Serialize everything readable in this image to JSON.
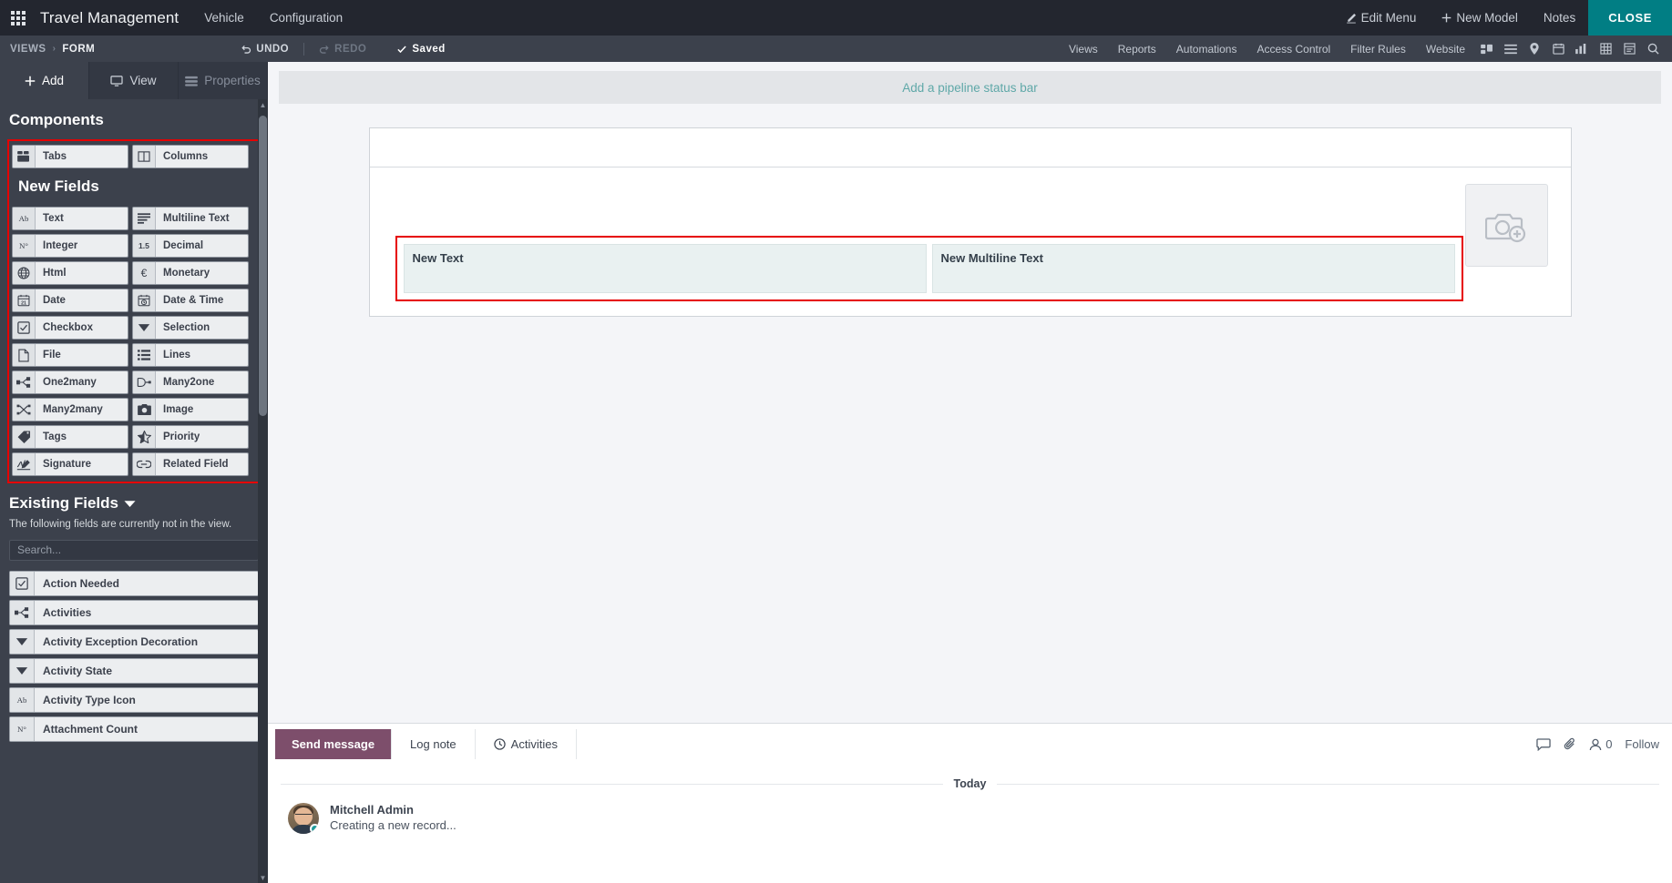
{
  "navbar": {
    "apps_icon": "apps-grid-icon",
    "brand": "Travel Management",
    "menus": [
      {
        "label": "Vehicle"
      },
      {
        "label": "Configuration"
      }
    ],
    "right_items": [
      {
        "label": "Edit Menu",
        "icon": "pencil-icon"
      },
      {
        "label": "New Model",
        "icon": "plus-icon"
      },
      {
        "label": "Notes",
        "icon": ""
      }
    ],
    "close_label": "CLOSE"
  },
  "subbar": {
    "breadcrumb": [
      {
        "label": "VIEWS",
        "active": false
      },
      {
        "label": "FORM",
        "active": true
      }
    ],
    "separator": "›",
    "undo_label": "UNDO",
    "redo_label": "REDO",
    "saved_label": "Saved",
    "links": [
      {
        "label": "Views"
      },
      {
        "label": "Reports"
      },
      {
        "label": "Automations"
      },
      {
        "label": "Access Control"
      },
      {
        "label": "Filter Rules"
      },
      {
        "label": "Website"
      }
    ],
    "view_icons": [
      "kanban-icon",
      "list-icon",
      "map-icon",
      "calendar-icon",
      "graph-icon",
      "pivot-icon",
      "form-icon",
      "search-icon"
    ]
  },
  "sidebar": {
    "tabs": [
      {
        "label": "Add",
        "icon": "plus-icon",
        "active": true,
        "dim": false
      },
      {
        "label": "View",
        "icon": "monitor-icon",
        "active": false,
        "dim": false
      },
      {
        "label": "Properties",
        "icon": "properties-icon",
        "active": false,
        "dim": true
      }
    ],
    "components_heading": "Components",
    "components": [
      {
        "label": "Tabs",
        "icon": "tabs-icon"
      },
      {
        "label": "Columns",
        "icon": "columns-icon"
      }
    ],
    "new_fields_heading": "New Fields",
    "new_fields": [
      {
        "label": "Text",
        "icon": "ab-icon"
      },
      {
        "label": "Multiline Text",
        "icon": "lines-text-icon"
      },
      {
        "label": "Integer",
        "icon": "n-degree-icon"
      },
      {
        "label": "Decimal",
        "icon": "decimal-icon"
      },
      {
        "label": "Html",
        "icon": "globe-icon"
      },
      {
        "label": "Monetary",
        "icon": "euro-icon"
      },
      {
        "label": "Date",
        "icon": "calendar-21-icon"
      },
      {
        "label": "Date & Time",
        "icon": "calendar-clock-icon"
      },
      {
        "label": "Checkbox",
        "icon": "checkbox-icon"
      },
      {
        "label": "Selection",
        "icon": "caret-down-icon"
      },
      {
        "label": "File",
        "icon": "file-icon"
      },
      {
        "label": "Lines",
        "icon": "list-bullets-icon"
      },
      {
        "label": "One2many",
        "icon": "one2many-icon"
      },
      {
        "label": "Many2one",
        "icon": "many2one-icon"
      },
      {
        "label": "Many2many",
        "icon": "many2many-icon"
      },
      {
        "label": "Image",
        "icon": "camera-icon"
      },
      {
        "label": "Tags",
        "icon": "tag-icon"
      },
      {
        "label": "Priority",
        "icon": "half-star-icon"
      },
      {
        "label": "Signature",
        "icon": "signature-icon"
      },
      {
        "label": "Related Field",
        "icon": "link-icon"
      }
    ],
    "existing_fields_heading": "Existing Fields",
    "existing_fields_caret": "caret-down-icon",
    "existing_fields_desc": "The following fields are currently not in the view.",
    "search_placeholder": "Search...",
    "existing_fields": [
      {
        "label": "Action Needed",
        "icon": "checkbox-icon"
      },
      {
        "label": "Activities",
        "icon": "one2many-icon"
      },
      {
        "label": "Activity Exception Decoration",
        "icon": "caret-down-icon"
      },
      {
        "label": "Activity State",
        "icon": "caret-down-icon"
      },
      {
        "label": "Activity Type Icon",
        "icon": "ab-icon"
      },
      {
        "label": "Attachment Count",
        "icon": "n-degree-icon"
      }
    ]
  },
  "main": {
    "pipeline_placeholder": "Add a pipeline status bar",
    "image_placeholder_icon": "camera-plus-icon",
    "form_fields": [
      {
        "label": "New Text",
        "name": "new-text-field"
      },
      {
        "label": "New Multiline Text",
        "name": "new-multiline-text-field"
      }
    ]
  },
  "chatter": {
    "send_message_label": "Send message",
    "log_note_label": "Log note",
    "activities_label": "Activities",
    "activities_icon": "clock-icon",
    "right_icons": [
      {
        "name": "attachment-paperclip-icon"
      },
      {
        "name": "attachment-icon"
      }
    ],
    "followers_count": "0",
    "followers_icon": "user-icon",
    "follow_label": "Follow",
    "today_label": "Today",
    "messages": [
      {
        "author": "Mitchell Admin",
        "text": "Creating a new record...",
        "avatar": "mitchell-admin-avatar",
        "online": true
      }
    ]
  }
}
